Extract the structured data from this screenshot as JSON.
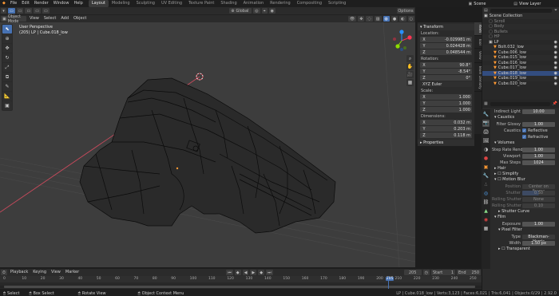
{
  "topbar": {
    "menus": [
      "File",
      "Edit",
      "Render",
      "Window",
      "Help"
    ],
    "workspaces": [
      "Layout",
      "Modeling",
      "Sculpting",
      "UV Editing",
      "Texture Paint",
      "Shading",
      "Animation",
      "Rendering",
      "Compositing",
      "Scripting"
    ],
    "active_workspace": "Layout",
    "scene_label": "Scene",
    "view_layer_label": "View Layer"
  },
  "header3d": {
    "mode": "Object Mode",
    "menus": [
      "View",
      "Select",
      "Add",
      "Object"
    ],
    "orientation": "Global",
    "options": "Options"
  },
  "viewport": {
    "view_name": "User Perspective",
    "collection_info": "(205) LP | Cube.018_low"
  },
  "npanel": {
    "transform_title": "Transform",
    "location_label": "Location:",
    "location": [
      {
        "axis": "X",
        "value": "-0.029981 m"
      },
      {
        "axis": "Y",
        "value": "0.024428 m"
      },
      {
        "axis": "Z",
        "value": "0.048544 m"
      }
    ],
    "rotation_label": "Rotation:",
    "rotation": [
      {
        "axis": "X",
        "value": "90.8°"
      },
      {
        "axis": "Y",
        "value": "-8.54°"
      },
      {
        "axis": "Z",
        "value": "0°"
      }
    ],
    "rotation_mode": "XYZ Euler",
    "scale_label": "Scale:",
    "scale": [
      {
        "axis": "X",
        "value": "1.000"
      },
      {
        "axis": "Y",
        "value": "1.000"
      },
      {
        "axis": "Z",
        "value": "1.000"
      }
    ],
    "dimensions_label": "Dimensions:",
    "dimensions": [
      {
        "axis": "X",
        "value": "0.032 m"
      },
      {
        "axis": "Y",
        "value": "0.203 m"
      },
      {
        "axis": "Z",
        "value": "0.118 m"
      }
    ],
    "properties_title": "Properties"
  },
  "side_tabs": [
    "Item",
    "Tool",
    "View",
    "Texel Density"
  ],
  "outliner": {
    "title": "Scene Collection",
    "items": [
      "Scroll",
      "Body",
      "Bullets",
      "HP",
      "LP",
      "Bolt.032_low",
      "Cube.006_low",
      "Cube.015_low",
      "Cube.016_low",
      "Cube.017_low",
      "Cube.018_low",
      "Cube.019_low",
      "Cube.020_low"
    ]
  },
  "props": {
    "indirect_light_label": "Indirect Light",
    "indirect_light": "10.00",
    "caustics_title": "Caustics",
    "filter_glossy_label": "Filter Glossy",
    "filter_glossy": "1.00",
    "caustics_label": "Caustics",
    "reflective": "Reflective",
    "refractive": "Refractive",
    "volumes_title": "Volumes",
    "step_rate_label": "Step Rate Rend...",
    "step_rate": "1.00",
    "viewport_label": "Viewport",
    "viewport_val": "1.00",
    "max_steps_label": "Max Steps",
    "max_steps": "1024",
    "hair_title": "Hair",
    "simplify_title": "Simplify",
    "motion_blur_title": "Motion Blur",
    "position_label": "Position",
    "position": "Center on Frame",
    "shutter_label": "Shutter",
    "shutter": "0.50",
    "rolling_label": "Rolling Shutter",
    "rolling": "None",
    "rolling_dur_label": "Rolling Shutter",
    "rolling_dur": "0.10",
    "shutter_curve_title": "Shutter Curve",
    "film_title": "Film",
    "exposure_label": "Exposure",
    "exposure": "1.00",
    "pixel_filter_title": "Pixel Filter",
    "type_label": "Type",
    "type": "Blackman-Harris",
    "width_label": "Width",
    "width": "1.50 px",
    "transparent": "Transparent"
  },
  "timeline": {
    "menus": [
      "Playback",
      "Keying",
      "View",
      "Marker"
    ],
    "current_frame": "205",
    "start_label": "Start",
    "start": "1",
    "end_label": "End",
    "end": "250",
    "ticks": [
      "0",
      "10",
      "20",
      "30",
      "40",
      "50",
      "60",
      "70",
      "80",
      "90",
      "100",
      "110",
      "120",
      "130",
      "140",
      "150",
      "160",
      "170",
      "180",
      "190",
      "200",
      "205",
      "210",
      "220",
      "230",
      "240",
      "250"
    ]
  },
  "statusbar": {
    "select": "Select",
    "box_select": "Box Select",
    "rotate_view": "Rotate View",
    "context_menu": "Object Context Menu",
    "stats": "LP | Cube.018_low | Verts:3,123 | Faces:6,021 | Tris:6,041 | Objects:0/29 | 2.92.0"
  },
  "colors": {
    "accent": "#4772b3",
    "object_orange": "#ff9933",
    "x_axis": "#ff3352",
    "y_axis": "#8bdc00",
    "z_axis": "#2890ff"
  }
}
